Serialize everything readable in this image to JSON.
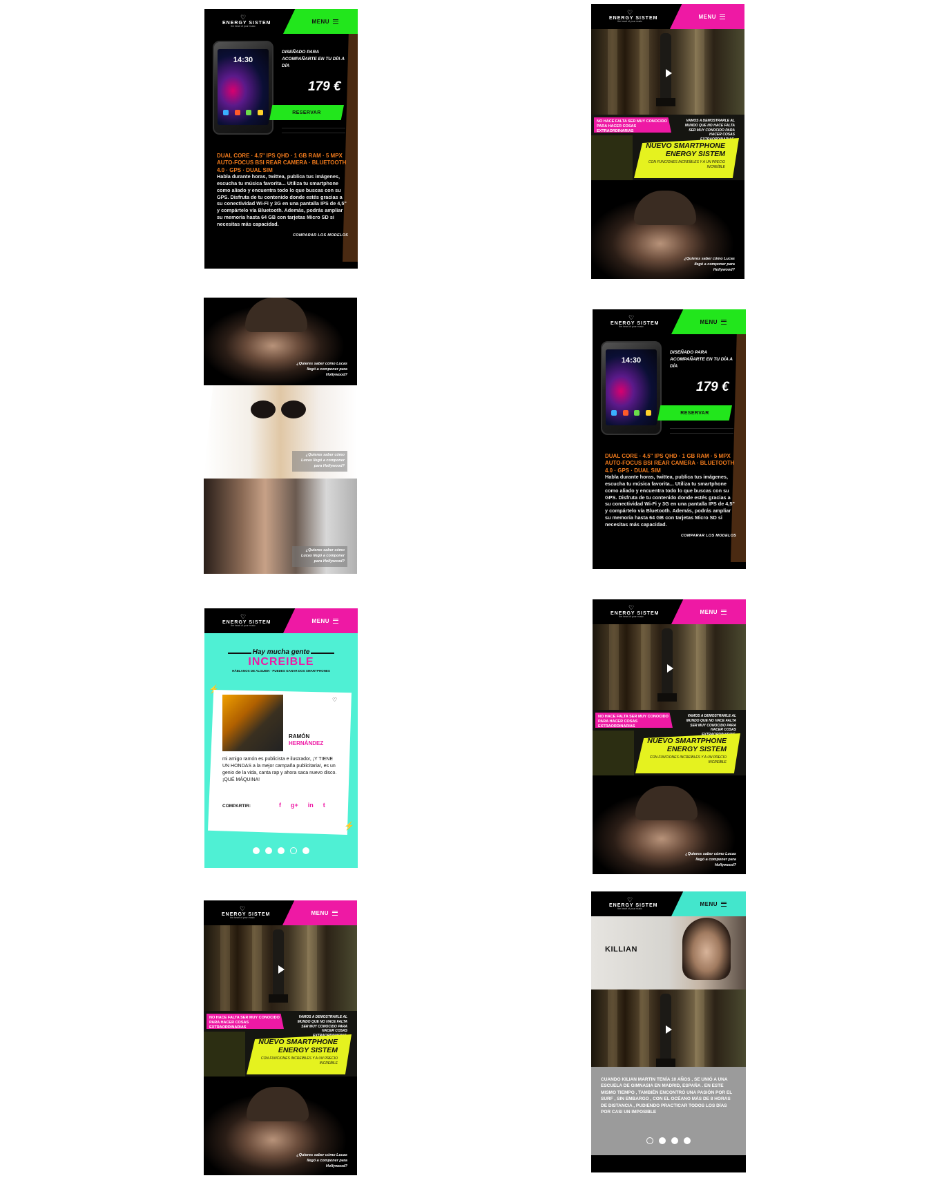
{
  "brand": {
    "name": "ENERGY SISTEM",
    "tagline": "the heart of your music",
    "heart": "♡"
  },
  "menu": {
    "label": "MENU"
  },
  "colors": {
    "green": "#22e61c",
    "magenta": "#ee19a4",
    "teal": "#43e6cc",
    "yellow": "#e5f21f",
    "orange": "#f07a1c"
  },
  "product": {
    "tagline": "DISEÑADO PARA ACOMPAÑARTE EN TU DÍA A DÍA",
    "price": "179 €",
    "reserve_label": "RESERVAR",
    "phone_time": "14:30",
    "specs": "DUAL CORE · 4.5\" IPS QHD · 1 GB RAM · 5 MPX AUTO-FOCUS BSI REAR CAMERA · BLUETOOTH 4.0 · GPS · DUAL SIM",
    "description": "Habla durante horas, twittea, publica tus imágenes, escucha tu música favorita... Utiliza tu smartphone como aliado y encuentra todo lo que buscas con su GPS. Disfruta de tu contenido donde estés gracias a su conectividad Wi-Fi y 3G en una pantalla IPS de 4,5\" y compártelo vía Bluetooth. Además, podrás ampliar su memoria hasta 64 GB con tarjetas Micro SD si necesitas más capacidad.",
    "compare_label": "COMPARAR LOS MODELOS"
  },
  "campaign": {
    "pink_banner": "NO HACE FALTA SER MUY CONOCIDO PARA HACER COSAS EXTRAORDINARIAS",
    "blurb": "VAMOS A DEMOSTRARLE AL MUNDO QUE NO HACE FALTA SER MUY CONOCIDO PARA HACER COSAS EXTRAORDINARIAS.",
    "headline": "NUEVO SMARTPHONE ENERGY SISTEM",
    "subline": "CON FUNCIONES INCREÍBLES Y A UN PRECIO INCREÍBLE",
    "question": "¿Quieres saber cómo Lucas llegó a componer para Hollywood?"
  },
  "community": {
    "title_script": "Hay mucha gente",
    "title_big": "INCREIBLE",
    "subtitle": "HÁBLANOS DE ALGUIEN · PUEDES GANAR DOS SMARTPHONES",
    "person_first": "RAMÓN",
    "person_last": "HERNÁNDEZ",
    "text": "mi amigo ramón es publicista e ilustrador, ¡Y TIENE UN HONDAS a la mejor campaña publicitaria!, es un genio de la vida, canta rap y ahora saca nuevo disco. ¡QUÉ MÁQUINA!",
    "share_label": "COMPARTIR:",
    "socials": [
      "f",
      "g+",
      "in",
      "t"
    ]
  },
  "killian": {
    "name": "KILLIAN",
    "text": "CUANDO KILIAN MARTIN TENÍA 10 AÑOS , SE UNIÓ A UNA ESCUELA DE GIMNASIA EN MADRID, ESPAÑA . EN ESTE MISMO TIEMPO , TAMBIÉN ENCONTRÓ UNA PASIÓN POR EL SURF , SIN EMBARGO , CON EL OCÉANO MÁS DE 8 HORAS DE DISTANCIA , PUDIENDO PRACTICAR TODOS LOS DÍAS POR CASI UN IMPOSIBLE"
  }
}
